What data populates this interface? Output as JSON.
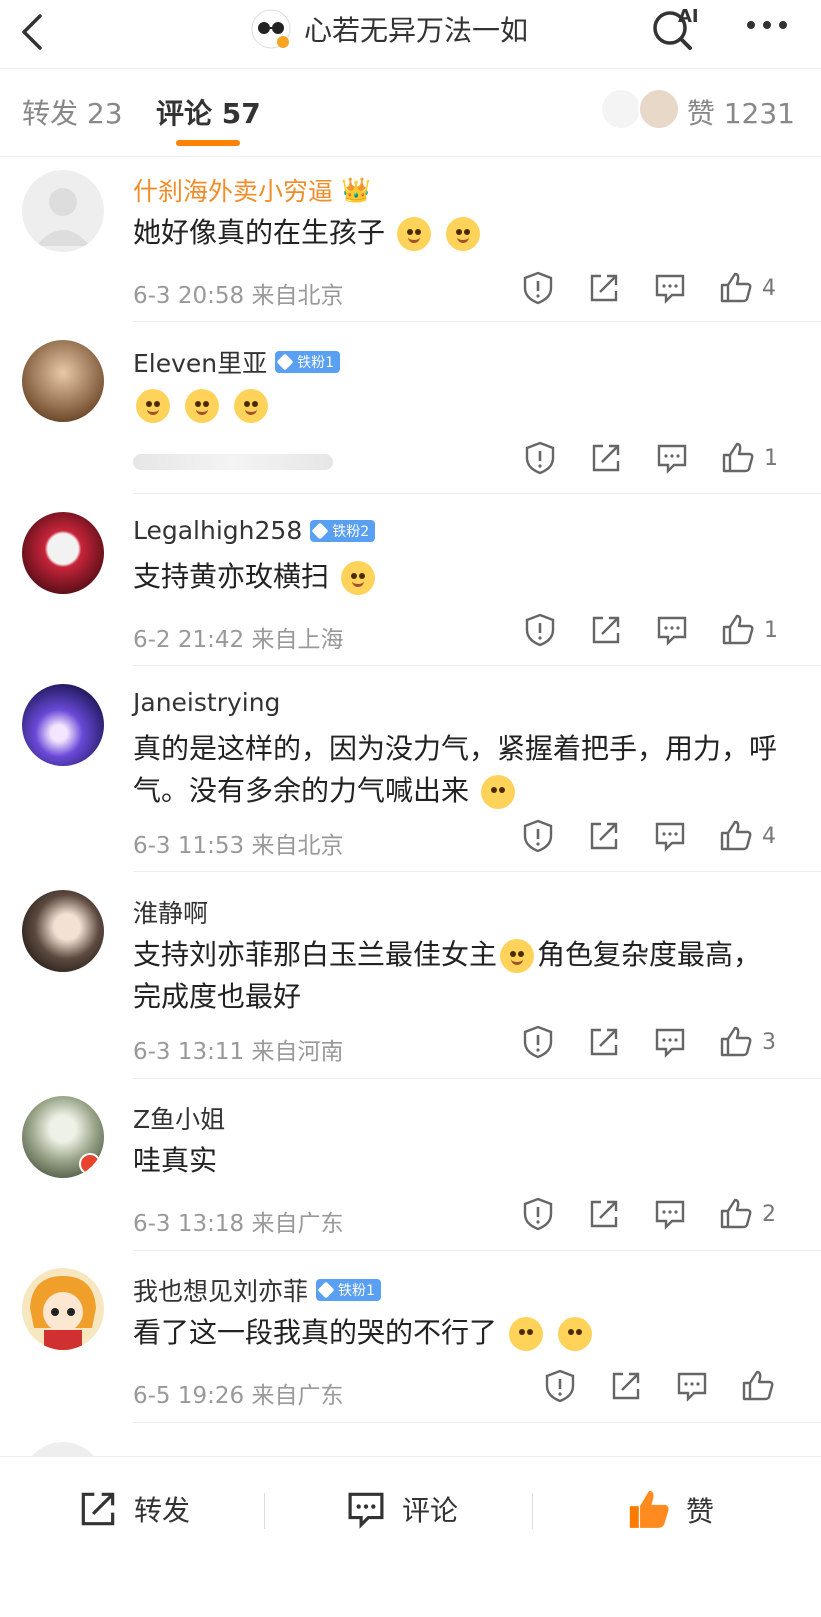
{
  "header": {
    "title": "心若无异万法一如"
  },
  "tabs": {
    "repost_label": "转发",
    "repost_count": "23",
    "comment_label": "评论",
    "comment_count": "57",
    "like_label": "赞",
    "like_count": "1231"
  },
  "comments": [
    {
      "name": "什刹海外卖小穷逼",
      "text": "她好像真的在生孩子",
      "time": "6-3 20:58",
      "location": "来自北京",
      "likes": "4"
    },
    {
      "name": "Eleven里亚",
      "badge": "铁粉1",
      "text": "",
      "time": "",
      "location": "",
      "likes": "1"
    },
    {
      "name": "Legalhigh258",
      "badge": "铁粉2",
      "text": "支持黄亦玫横扫",
      "time": "6-2 21:42",
      "location": "来自上海",
      "likes": "1"
    },
    {
      "name": "Janeistrying",
      "text": "真的是这样的，因为没力气，紧握着把手，用力，呼气。没有多余的力气喊出来",
      "time": "6-3 11:53",
      "location": "来自北京",
      "likes": "4"
    },
    {
      "name": "淮静啊",
      "text": "支持刘亦菲那白玉兰最佳女主",
      "text2": "角色复杂度最高，完成度也最好",
      "time": "6-3 13:11",
      "location": "来自河南",
      "likes": "3"
    },
    {
      "name": "Z鱼小姐",
      "text": "哇真实",
      "time": "6-3 13:18",
      "location": "来自广东",
      "likes": "2"
    },
    {
      "name": "我也想见刘亦菲",
      "badge": "铁粉1",
      "text": "看了这一段我真的哭的不行了",
      "time": "6-5 19:26",
      "location": "来自广东",
      "likes": ""
    }
  ],
  "bottom": {
    "repost": "转发",
    "comment": "评论",
    "like": "赞"
  },
  "colors": {
    "accent": "#ff8200",
    "badge": "#5aa0f2",
    "vip_name": "#f28c28"
  }
}
